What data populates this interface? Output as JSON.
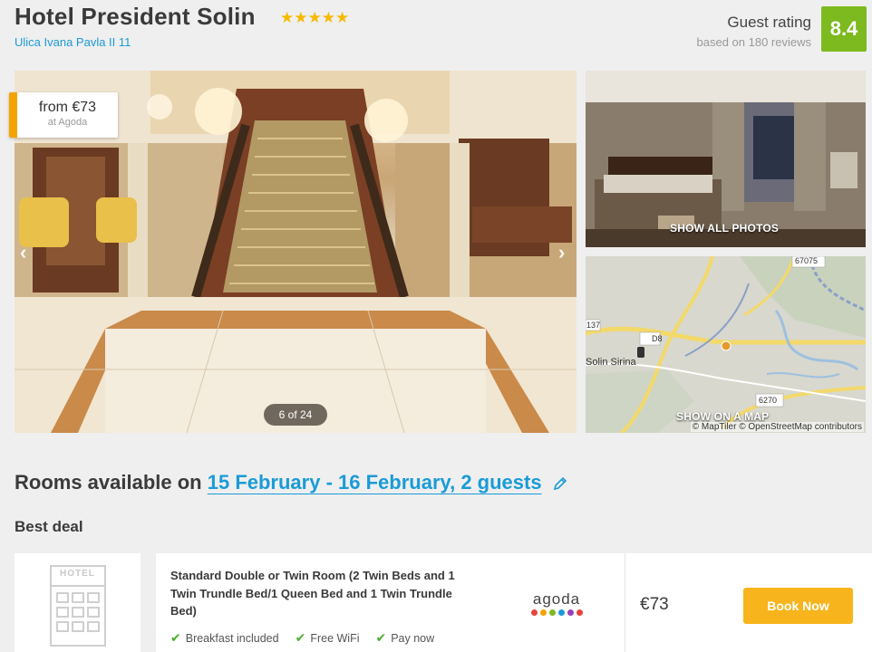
{
  "header": {
    "title": "Hotel President Solin",
    "stars": "★★★★★",
    "star_count": 5,
    "address": "Ulica Ivana Pavla II 11",
    "rating_label": "Guest rating",
    "rating_reviews": "based on 180 reviews",
    "rating_score": "8.4"
  },
  "gallery": {
    "price_from": "from €73",
    "price_source": "at Agoda",
    "counter": "6 of 24",
    "prev_icon": "chevron-left-icon",
    "next_icon": "chevron-right-icon",
    "show_photos_label": "SHOW ALL PHOTOS",
    "show_map_label": "SHOW ON A MAP",
    "map_credit": "© MapTiler © OpenStreetMap contributors",
    "map_labels": {
      "road_d8": "D8",
      "place": "Solin Sirina",
      "road_6270": "6270",
      "road_67075": "67075",
      "road_137": "137"
    }
  },
  "rooms": {
    "heading_prefix": "Rooms available on ",
    "dates": "15 February - 16 February, 2 guests",
    "best_deal_label": "Best deal",
    "hotel_placeholder_text": "HOTEL",
    "deal": {
      "room_name": "Standard Double or Twin Room (2 Twin Beds and 1 Twin Trundle Bed/1 Queen Bed and 1 Twin Trundle Bed)",
      "amenities": [
        "Breakfast included",
        "Free WiFi",
        "Pay now"
      ],
      "provider": "agoda",
      "provider_dot_colors": [
        "#e8443a",
        "#f5a300",
        "#7dba1f",
        "#1a9bd7",
        "#9c3fb5",
        "#e8443a"
      ],
      "price": "€73",
      "book_label": "Book Now"
    }
  },
  "colors": {
    "accent_blue": "#1a9bd7",
    "rating_green": "#7dba1f",
    "book_yellow": "#f7b41c",
    "price_tag_orange": "#f5a300"
  }
}
